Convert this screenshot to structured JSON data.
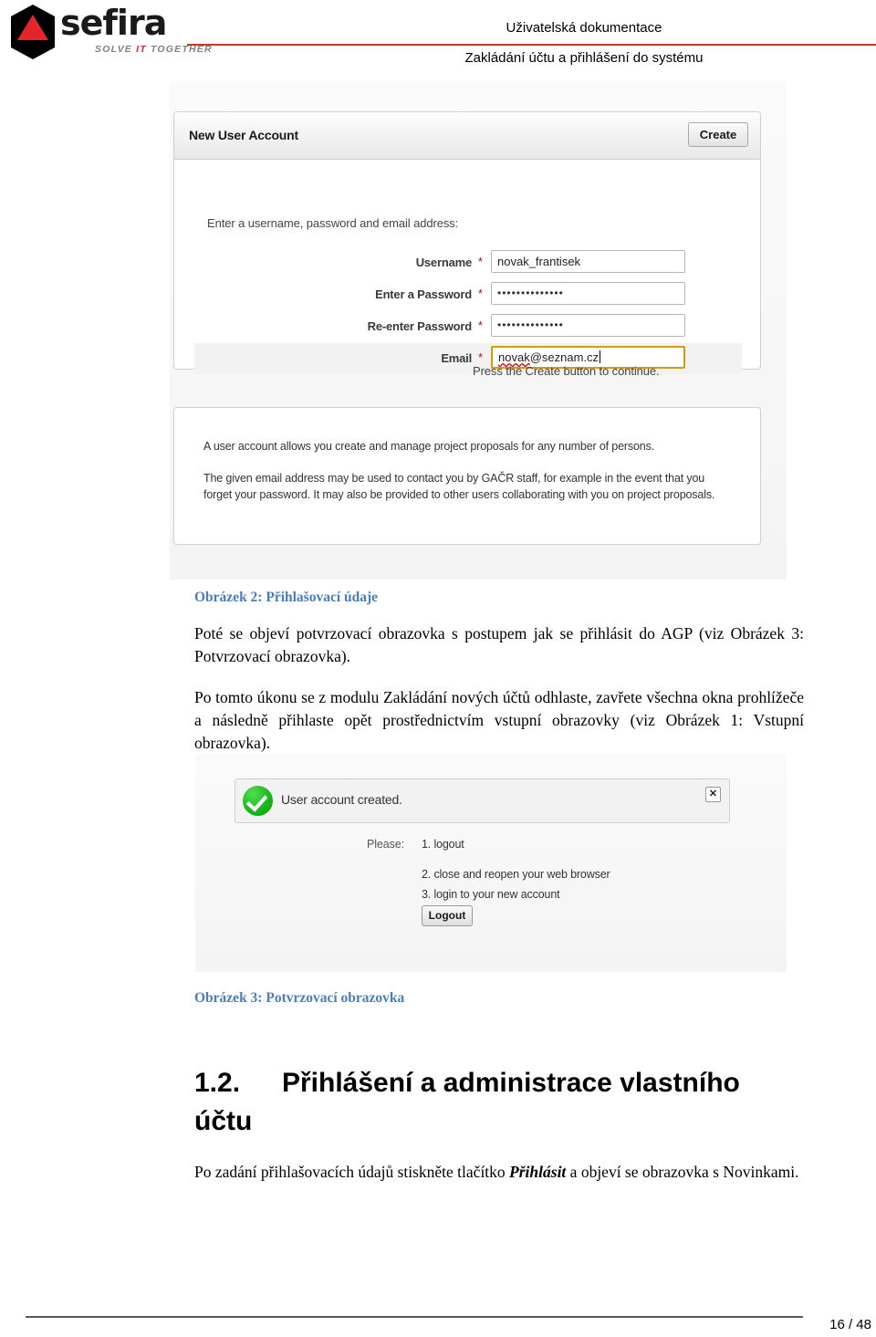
{
  "header": {
    "logo_word": "sefira",
    "tagline_pre": "SOLVE ",
    "tagline_it": "IT",
    "tagline_post": " TOGETHER",
    "line1": "Uživatelská dokumentace",
    "line2": "Zakládání účtu a přihlášení do systému",
    "rule_color": "#c0392b"
  },
  "screenshot_new_account": {
    "panel_title": "New User Account",
    "create_label": "Create",
    "intro": "Enter a username, password and email address:",
    "fields": [
      {
        "label": "Username",
        "required": "*",
        "value": "novak_frantisek",
        "type": "text"
      },
      {
        "label": "Enter a Password",
        "required": "*",
        "value": "••••••••••••••",
        "type": "password"
      },
      {
        "label": "Re-enter Password",
        "required": "*",
        "value": "••••••••••••••",
        "type": "password"
      },
      {
        "label": "Email",
        "required": "*",
        "value": "novak@seznam.cz",
        "type": "email",
        "value_misspelled": "novak",
        "value_rest": "@seznam.cz"
      }
    ],
    "hint": "Press the Create button to continue.",
    "info_p1": "A user account allows you create and manage project proposals for any number of persons.",
    "info_p2": "The given email address may be used to contact you by GAČR staff, for example in the event that you forget your password. It may also be provided to other users collaborating with you on project proposals."
  },
  "screenshot_confirmation": {
    "alert_text": "User account created.",
    "close_label": "✕",
    "please_label": "Please:",
    "steps": [
      "1. logout",
      "2. close and reopen your web browser",
      "3. login to your new account"
    ],
    "logout_label": "Logout"
  },
  "captions": {
    "figure_2": "Obrázek 2: Přihlašovací údaje",
    "figure_3": "Obrázek 3: Potvrzovací obrazovka",
    "color": "#4a7ebb"
  },
  "body": {
    "para_1": "Poté se objeví potvrzovací obrazovka s postupem jak se přihlásit do AGP (viz Obrázek 3: Potvrzovací obrazovka).",
    "para_2": "Po tomto úkonu se z modulu Zakládání nových účtů odhlaste, zavřete všechna okna prohlížeče a následně přihlaste opět prostřednictvím vstupní obrazovky (viz Obrázek 1: Vstupní obrazovka).",
    "para_3_before": "Po zadání přihlašovacích údajů stiskněte tlačítko ",
    "para_3_bold": "Přihlásit",
    "para_3_after": " a objeví se obrazovka s Novinkami."
  },
  "section": {
    "number": "1.2.",
    "title": "Přihlášení a administrace vlastního účtu"
  },
  "footer": {
    "page": "16 / 48"
  }
}
